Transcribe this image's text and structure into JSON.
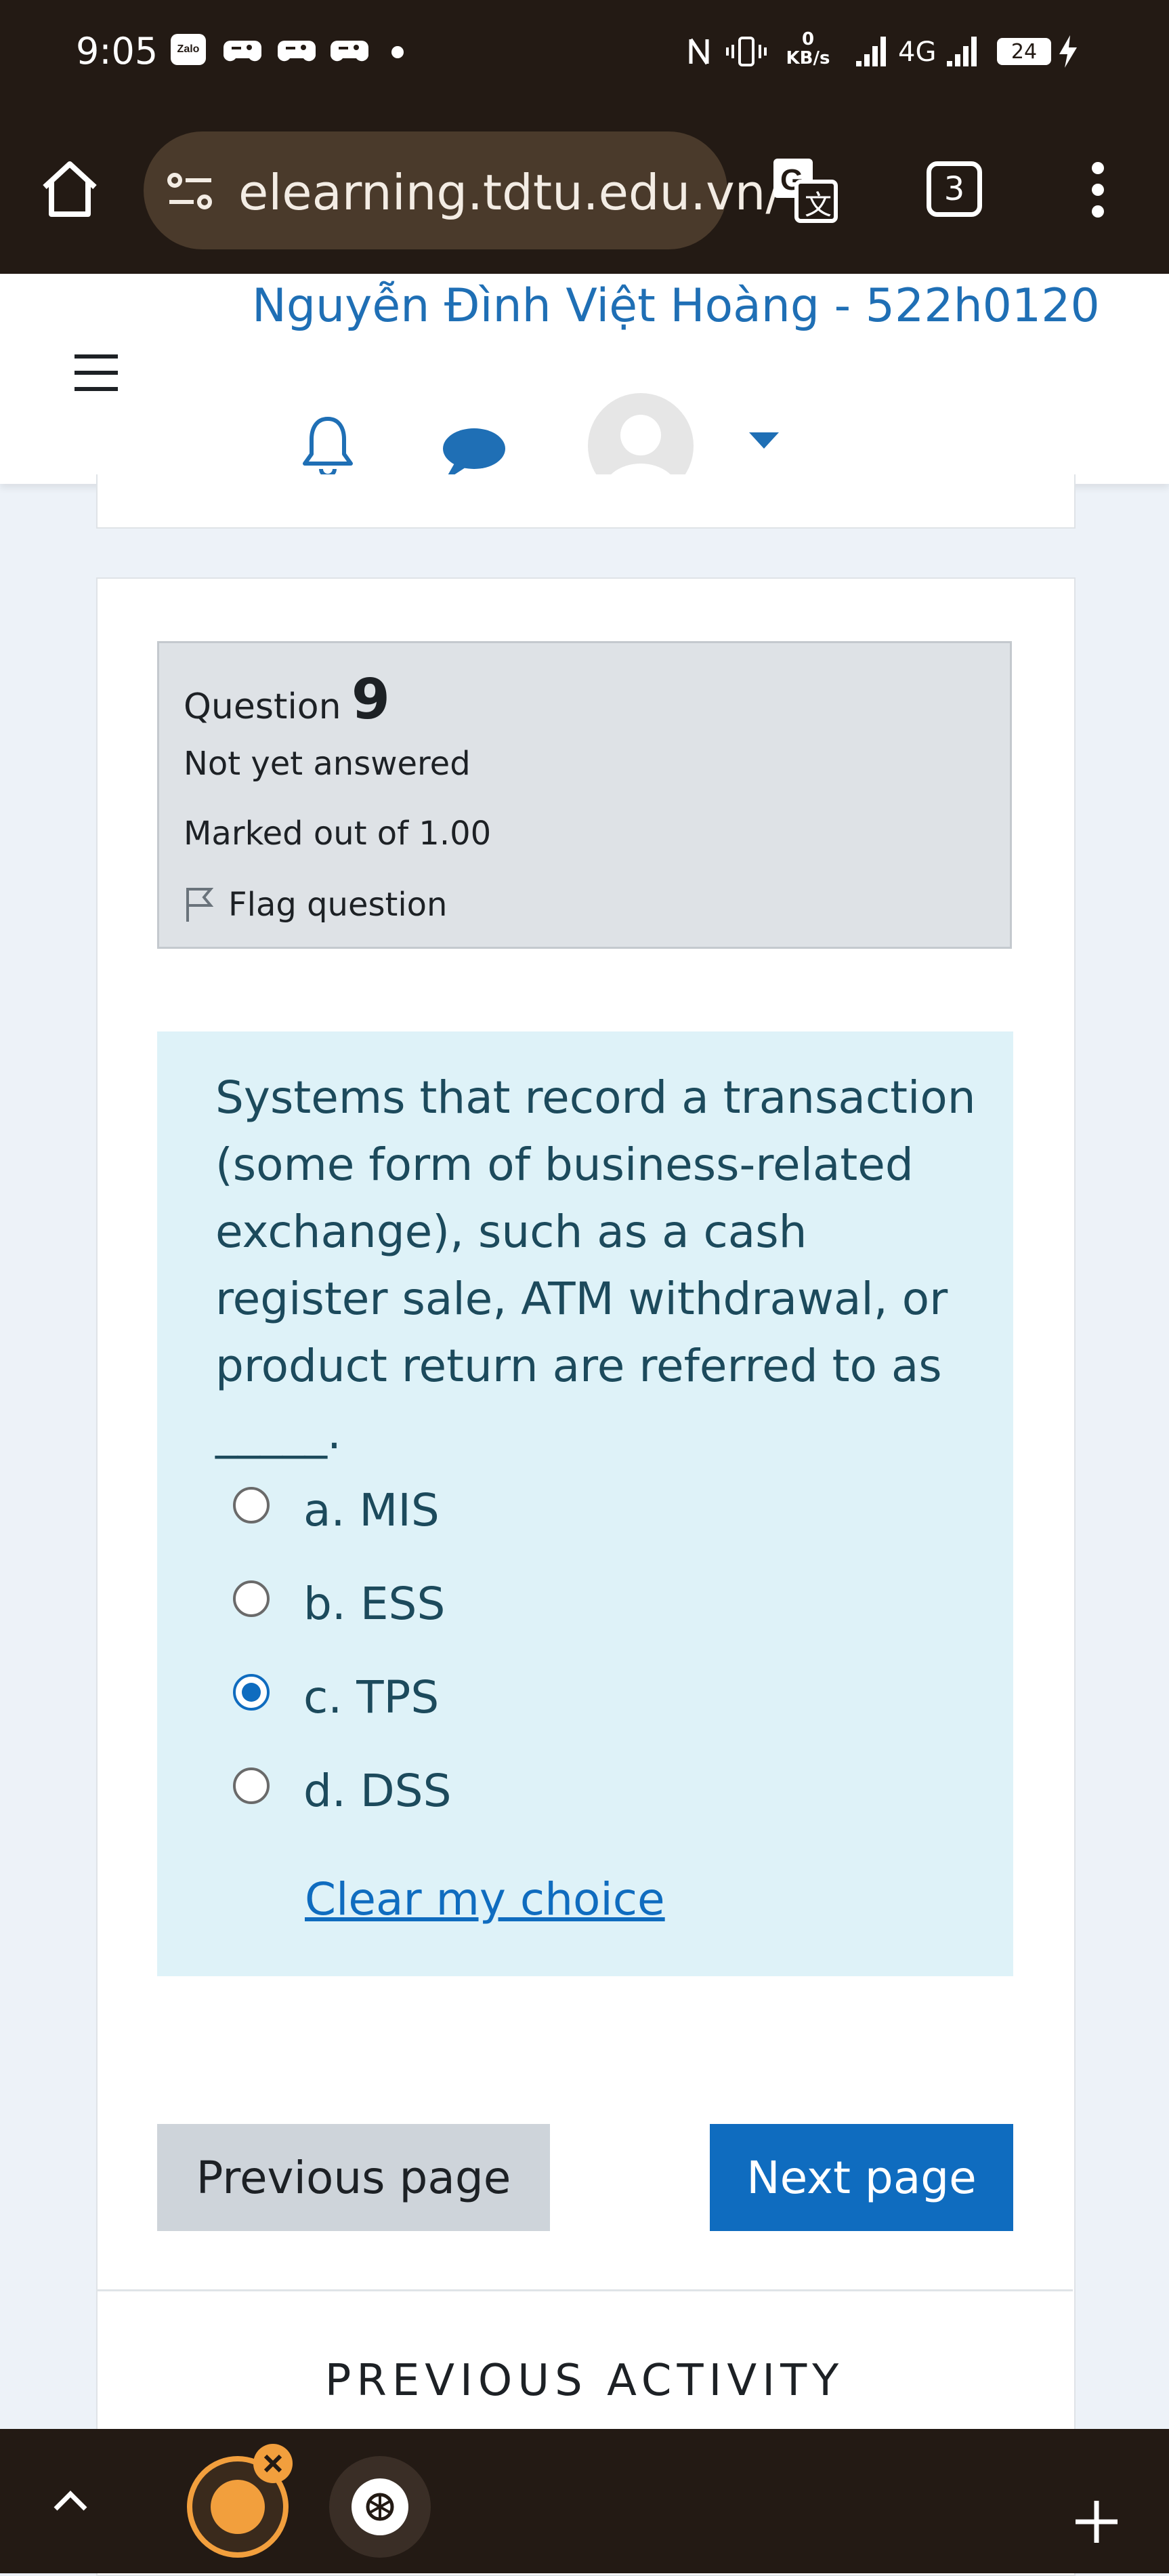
{
  "status_bar": {
    "time": "9:05",
    "network_speed_value": "0",
    "network_speed_unit": "KB/s",
    "network_type": "4G",
    "battery": "24"
  },
  "browser": {
    "url": "elearning.tdtu.edu.vn/",
    "tab_count": "3"
  },
  "header": {
    "user_name": "Nguyễn Đình Việt Hoàng - 522h0120"
  },
  "question_info": {
    "label": "Question",
    "number": "9",
    "state": "Not yet answered",
    "marks": "Marked out of 1.00",
    "flag_label": "Flag question"
  },
  "question": {
    "text": "Systems that record a transaction (some form of business-related exchange), such as a cash register sale, ATM withdrawal, or product return are referred to as _____.",
    "options": [
      {
        "label": "a. MIS",
        "checked": false
      },
      {
        "label": "b. ESS",
        "checked": false
      },
      {
        "label": "c. TPS",
        "checked": true
      },
      {
        "label": "d. DSS",
        "checked": false
      }
    ],
    "clear_label": "Clear my choice"
  },
  "navigation": {
    "previous_label": "Previous page",
    "next_label": "Next page"
  },
  "footer": {
    "previous_activity_label": "PREVIOUS ACTIVITY"
  },
  "colors": {
    "brand_blue": "#0f6cbf",
    "chrome_bg": "#231a14",
    "question_bg": "#def2f8",
    "info_bg": "#dee2e6"
  }
}
